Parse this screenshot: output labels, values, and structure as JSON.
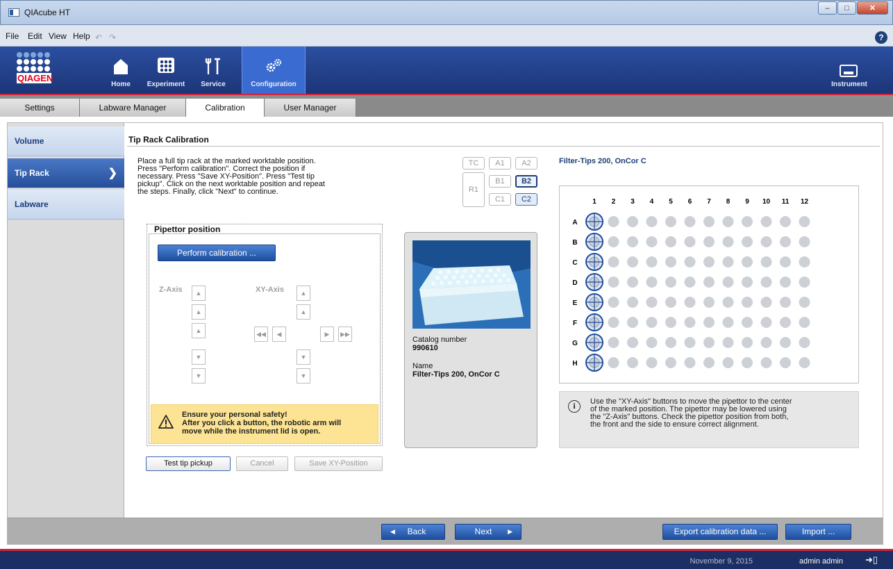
{
  "window": {
    "title": "QIAcube HT"
  },
  "menu": {
    "file": "File",
    "edit": "Edit",
    "view": "View",
    "help": "Help",
    "help_icon": "?"
  },
  "topnav": {
    "logo_text": "QIAGEN",
    "home": "Home",
    "experiment": "Experiment",
    "service": "Service",
    "configuration": "Configuration",
    "instrument": "Instrument"
  },
  "tabs": [
    "Settings",
    "Labware Manager",
    "Calibration",
    "User Manager"
  ],
  "sidebar": {
    "items": [
      {
        "label": "Volume"
      },
      {
        "label": "Tip Rack"
      },
      {
        "label": "Labware"
      }
    ]
  },
  "panel": {
    "title": "Tip Rack Calibration",
    "instructions": [
      "Place a full tip rack at the marked worktable position.",
      "Press \"Perform calibration\". Correct the position if",
      "necessary. Press \"Save XY-Position\". Press \"Test tip",
      "pickup\". Click on the next worktable position and repeat",
      "the steps. Finally, click \"Next\" to continue."
    ]
  },
  "worktable": {
    "tc": "TC",
    "a1": "A1",
    "a2": "A2",
    "r1": "R1",
    "b1": "B1",
    "b2": "B2",
    "c1": "C1",
    "c2": "C2"
  },
  "pipettor": {
    "legend": "Pipettor position",
    "perform_button": "Perform calibration ...",
    "z_axis_label": "Z-Axis",
    "xy_axis_label": "XY-Axis",
    "warning_line1": "Ensure your personal safety!",
    "warning_line2": "After you click a button, the robotic arm will",
    "warning_line3": "move while the instrument lid is open.",
    "test_button": "Test tip pickup",
    "cancel_button": "Cancel",
    "save_button": "Save XY-Position"
  },
  "product": {
    "catalog_label": "Catalog number",
    "catalog_value": "990610",
    "name_label": "Name",
    "name_value": "Filter-Tips 200, OnCor C"
  },
  "plate": {
    "title": "Filter-Tips 200, OnCor C",
    "columns": [
      "1",
      "2",
      "3",
      "4",
      "5",
      "6",
      "7",
      "8",
      "9",
      "10",
      "11",
      "12"
    ],
    "rows": [
      "A",
      "B",
      "C",
      "D",
      "E",
      "F",
      "G",
      "H"
    ],
    "marked_column": "1"
  },
  "info": [
    "Use the \"XY-Axis\" buttons to move the pipettor to the center",
    "of the marked position. The pipettor may be lowered using",
    "the \"Z-Axis\" buttons. Check the pipettor position from both,",
    "the front and the side to ensure correct alignment."
  ],
  "bottom": {
    "back": "Back",
    "next": "Next",
    "export": "Export calibration data ...",
    "import": "Import ..."
  },
  "status": {
    "date": "November 9, 2015",
    "user": "admin admin"
  }
}
